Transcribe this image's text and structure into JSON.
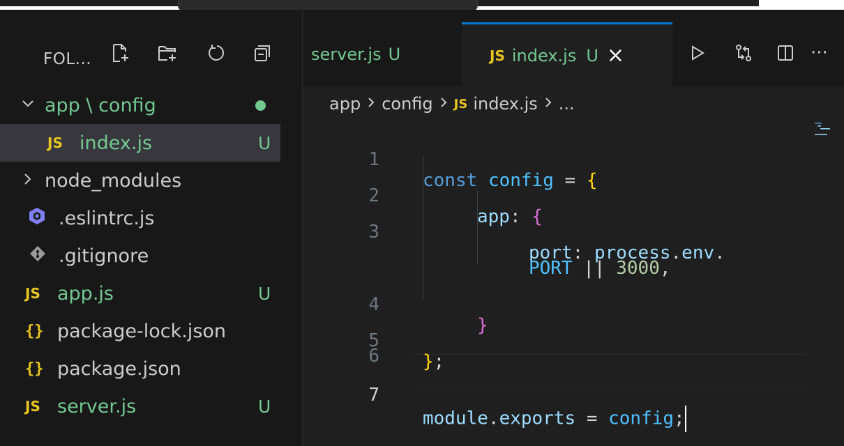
{
  "colors": {
    "accent": "#0078d4",
    "untracked_green": "#73c991",
    "js_yellow": "#e8c51f",
    "background": "#1f1f1f",
    "sidebar_bg": "#181818",
    "selected_row": "#37373d"
  },
  "sidebar": {
    "title": "FOL...",
    "actions": [
      {
        "icon": "new-file-icon"
      },
      {
        "icon": "new-folder-icon"
      },
      {
        "icon": "refresh-icon"
      },
      {
        "icon": "collapse-all-icon"
      }
    ],
    "tree": {
      "folder": {
        "label": "app \\ config",
        "expanded": true,
        "has_changes": true
      },
      "items": [
        {
          "label": "index.js",
          "icon": "js-icon",
          "icon_text": "JS",
          "badge": "U",
          "selected": true,
          "colored": true
        },
        {
          "label": "node_modules",
          "icon": "chevron-right-icon",
          "badge": "",
          "selected": false,
          "colored": false
        },
        {
          "label": ".eslintrc.js",
          "icon": "eslint-icon",
          "badge": "",
          "selected": false,
          "colored": false
        },
        {
          "label": ".gitignore",
          "icon": "git-icon",
          "badge": "",
          "selected": false,
          "colored": false
        },
        {
          "label": "app.js",
          "icon": "js-icon",
          "icon_text": "JS",
          "badge": "U",
          "selected": false,
          "colored": true
        },
        {
          "label": "package-lock.json",
          "icon": "json-icon",
          "icon_text": "{}",
          "badge": "",
          "selected": false,
          "colored": false
        },
        {
          "label": "package.json",
          "icon": "json-icon",
          "icon_text": "{}",
          "badge": "",
          "selected": false,
          "colored": false
        },
        {
          "label": "server.js",
          "icon": "js-icon",
          "icon_text": "JS",
          "badge": "U",
          "selected": false,
          "colored": true
        }
      ]
    }
  },
  "tabs": [
    {
      "label": "server.js",
      "status": "U",
      "active": false
    },
    {
      "label": "index.js",
      "icon_text": "JS",
      "status": "U",
      "active": true,
      "close": "×"
    }
  ],
  "editor_actions": [
    {
      "icon": "run-icon"
    },
    {
      "icon": "compare-changes-icon"
    },
    {
      "icon": "split-editor-icon"
    },
    {
      "icon": "more-actions-icon",
      "text": "···"
    }
  ],
  "breadcrumb": {
    "parts": [
      "app",
      "config",
      "index.js",
      "..."
    ],
    "file_icon_text": "JS"
  },
  "code": {
    "current_line": 7,
    "lines": [
      {
        "n": "1",
        "text": "const config = {"
      },
      {
        "n": "2",
        "text": "app: {"
      },
      {
        "n": "3",
        "text": "port: process.env."
      },
      {
        "n": "",
        "text": "PORT || 3000,"
      },
      {
        "n": "4",
        "text": "}"
      },
      {
        "n": "5",
        "text": "};"
      },
      {
        "n": "6",
        "text": ""
      },
      {
        "n": "7",
        "text": "module.exports = config;"
      }
    ],
    "tokens": {
      "l1_kw": "const",
      "l1_var": "config",
      "l1_eq": "=",
      "l1_brace": "{",
      "l2_prop": "app",
      "l2_colon": ":",
      "l2_brace": "{",
      "l3_prop": "port",
      "l3_colon": ":",
      "l3_obj": "process",
      "l3_dot1": ".",
      "l3_env": "env",
      "l3_dot2": ".",
      "l3b_port": "PORT",
      "l3b_or": "||",
      "l3b_num": "3000",
      "l3b_comma": ",",
      "l4_brace": "}",
      "l5_brace": "}",
      "l5_semi": ";",
      "l7_module": "module",
      "l7_dot": ".",
      "l7_exports": "exports",
      "l7_eq": "=",
      "l7_var": "config",
      "l7_semi": ";"
    }
  }
}
